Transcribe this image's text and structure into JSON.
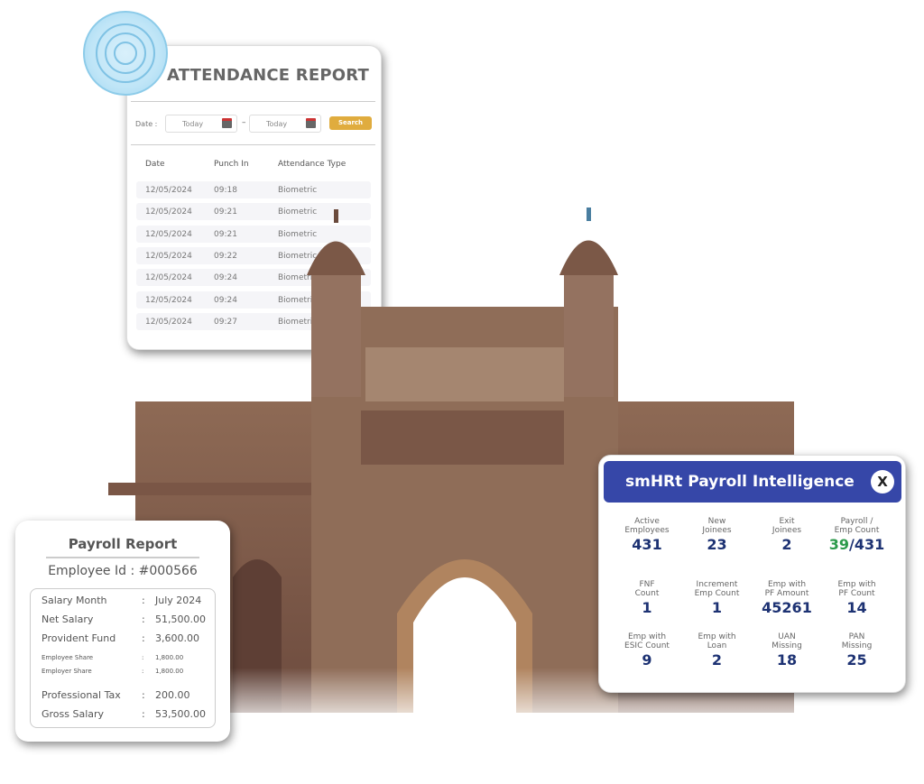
{
  "attendance": {
    "title": "ATTENDANCE REPORT",
    "date_label": "Date :",
    "from_value": "Today",
    "to_value": "Today",
    "separator": "–",
    "search_label": "Search",
    "columns": [
      "Date",
      "Punch In",
      "Attendance Type"
    ],
    "rows": [
      [
        "12/05/2024",
        "09:18",
        "Biometric"
      ],
      [
        "12/05/2024",
        "09:21",
        "Biometric"
      ],
      [
        "12/05/2024",
        "09:21",
        "Biometric"
      ],
      [
        "12/05/2024",
        "09:22",
        "Biometric"
      ],
      [
        "12/05/2024",
        "09:24",
        "Biometric"
      ],
      [
        "12/05/2024",
        "09:24",
        "Biometric"
      ],
      [
        "12/05/2024",
        "09:27",
        "Biometric"
      ]
    ]
  },
  "payroll": {
    "title": "Payroll Report",
    "employee": "Employee Id : #000566",
    "rows": [
      {
        "label": "Salary Month",
        "value": "July 2024",
        "small": false
      },
      {
        "label": "Net Salary",
        "value": "51,500.00",
        "small": false
      },
      {
        "label": "Provident Fund",
        "value": "3,600.00",
        "small": false
      },
      {
        "label": "Employee Share",
        "value": "1,800.00",
        "small": true
      },
      {
        "label": "Employer Share",
        "value": "1,800.00",
        "small": true
      },
      {
        "label": "Professional Tax",
        "value": "200.00",
        "small": false
      },
      {
        "label": "Gross Salary",
        "value": "53,500.00",
        "small": false
      }
    ]
  },
  "intel": {
    "title": "smHRt Payroll Intelligence",
    "close": "X",
    "stats": [
      {
        "label": "Active\nEmployees",
        "value": "431"
      },
      {
        "label": "New\nJoinees",
        "value": "23"
      },
      {
        "label": "Exit\nJoinees",
        "value": "2"
      },
      {
        "label": "Payroll /\nEmp Count",
        "value": "39",
        "value_total": "/431"
      },
      {
        "label": "FNF\nCount",
        "value": "1"
      },
      {
        "label": "Increment\nEmp Count",
        "value": "1"
      },
      {
        "label": "Emp with\nPF Amount",
        "value": "45261"
      },
      {
        "label": "Emp with\nPF Count",
        "value": "14"
      },
      {
        "label": "Emp with\nESIC Count",
        "value": "9"
      },
      {
        "label": "Emp with\nLoan",
        "value": "2"
      },
      {
        "label": "UAN\nMissing",
        "value": "18"
      },
      {
        "label": "PAN\nMissing",
        "value": "25"
      }
    ]
  },
  "colors": {
    "header_blue": "#3647a8",
    "value_navy": "#1d3273",
    "green": "#2b9a4a",
    "search_gold": "#e0ac3e",
    "stone": "#8a6450"
  }
}
